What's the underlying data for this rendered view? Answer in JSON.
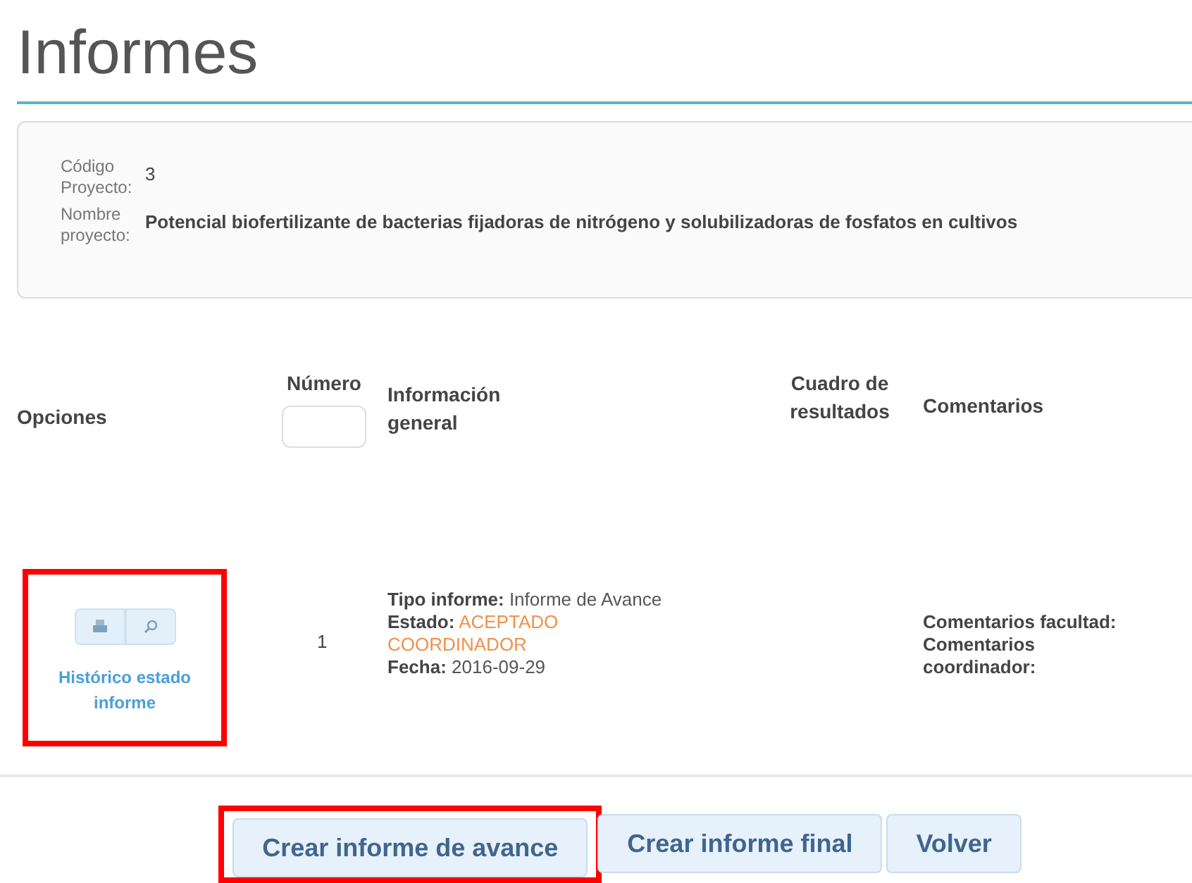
{
  "title": "Informes",
  "project": [
    {
      "label": "Código Proyecto:",
      "value": "3"
    },
    {
      "label": "Nombre proyecto:",
      "value": "Potencial biofertilizante de bacterias fijadoras de nitrógeno y solubilizadoras de fosfatos en cultivos"
    }
  ],
  "table": {
    "columns": [
      "Opciones",
      "Número",
      "Información general",
      "Cuadro de resultados",
      "Comentarios"
    ],
    "rows": [
      {
        "options_highlighted": true,
        "history_link": "Histórico estado informe",
        "numero": "1",
        "tipo_label": "Tipo informe:",
        "tipo": "Informe de Avance",
        "estado_label": "Estado:",
        "estado": "ACEPTADO COORDINADOR",
        "fecha_label": "Fecha:",
        "fecha": "2016-09-29",
        "comentarios": [
          "Comentarios facultad:",
          "Comentarios coordinador:"
        ]
      }
    ]
  },
  "buttons": [
    {
      "label": "Crear informe de avance",
      "highlighted": true
    },
    {
      "label": "Crear informe final",
      "highlighted": false
    },
    {
      "label": "Volver",
      "highlighted": false
    }
  ]
}
